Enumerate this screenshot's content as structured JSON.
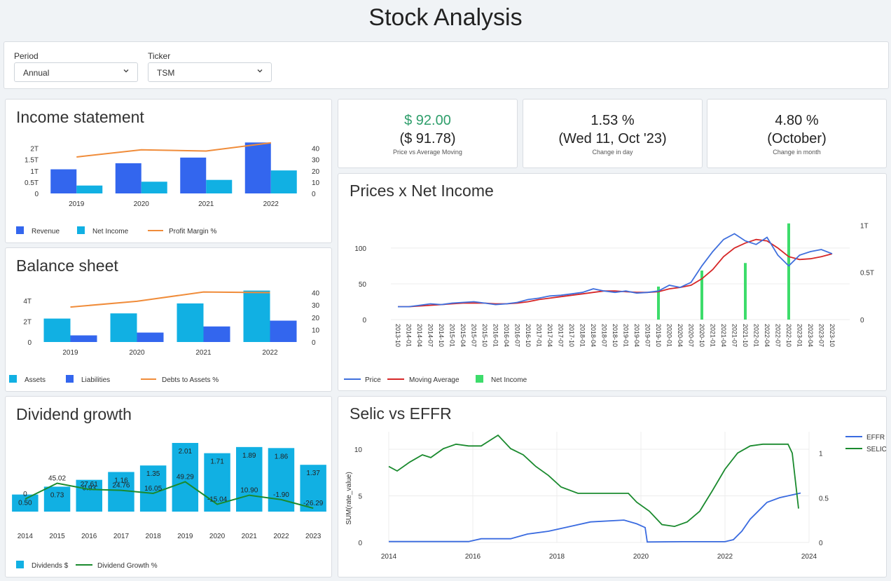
{
  "page": {
    "title": "Stock Analysis"
  },
  "filters": {
    "period": {
      "label": "Period",
      "value": "Annual"
    },
    "ticker": {
      "label": "Ticker",
      "value": "TSM"
    }
  },
  "kpis": [
    {
      "main": "$ 92.00",
      "sub": "($ 91.78)",
      "caption": "Price vs Average Moving",
      "main_color": "#2e9e6b"
    },
    {
      "main": "1.53 %",
      "sub": "(Wed 11, Oct '23)",
      "caption": "Change in day",
      "main_color": "#222222"
    },
    {
      "main": "4.80 %",
      "sub": "(October)",
      "caption": "Change in month",
      "main_color": "#222222"
    }
  ],
  "income": {
    "title": "Income statement",
    "chart_data": {
      "type": "bar",
      "categories": [
        "2019",
        "2020",
        "2021",
        "2022"
      ],
      "series": [
        {
          "name": "Revenue",
          "kind": "bar",
          "axis": "left",
          "color": "#3366ee",
          "values": [
            1.07,
            1.34,
            1.59,
            2.26
          ]
        },
        {
          "name": "Net Income",
          "kind": "bar",
          "axis": "left",
          "color": "#11b0e3",
          "values": [
            0.35,
            0.52,
            0.6,
            1.02
          ]
        },
        {
          "name": "Profit Margin %",
          "kind": "line",
          "axis": "right",
          "color": "#f08c3a",
          "values": [
            32.3,
            38.7,
            37.6,
            44.9
          ]
        }
      ],
      "yticks": [
        "0",
        "0.5T",
        "1T",
        "1.5T",
        "2T"
      ],
      "ylim": [
        0,
        2.3
      ],
      "y2ticks": [
        "0",
        "10",
        "20",
        "30",
        "40"
      ],
      "y2lim": [
        0,
        46
      ]
    }
  },
  "balance": {
    "title": "Balance sheet",
    "chart_data": {
      "type": "bar",
      "categories": [
        "2019",
        "2020",
        "2021",
        "2022"
      ],
      "series": [
        {
          "name": "Assets",
          "kind": "bar",
          "axis": "left",
          "color": "#11b0e3",
          "values": [
            2.26,
            2.76,
            3.72,
            4.96
          ]
        },
        {
          "name": "Liabilities",
          "kind": "bar",
          "axis": "left",
          "color": "#3366ee",
          "values": [
            0.64,
            0.91,
            1.5,
            2.06
          ]
        },
        {
          "name": "Debts to Assets %",
          "kind": "line",
          "axis": "right",
          "color": "#f08c3a",
          "values": [
            28.3,
            33,
            40.5,
            40
          ]
        }
      ],
      "yticks": [
        "0",
        "2T",
        "4T"
      ],
      "ylim": [
        0,
        5
      ],
      "y2ticks": [
        "0",
        "10",
        "20",
        "30",
        "40"
      ],
      "y2lim": [
        0,
        42
      ]
    }
  },
  "dividend": {
    "title": "Dividend growth",
    "chart_data": {
      "type": "bar",
      "categories": [
        "2014",
        "2015",
        "2016",
        "2017",
        "2018",
        "2019",
        "2020",
        "2021",
        "2022",
        "2023"
      ],
      "series": [
        {
          "name": "Dividends $",
          "kind": "bar",
          "color": "#11b0e3",
          "values": [
            0.5,
            0.73,
            0.93,
            1.16,
            1.35,
            2.01,
            1.71,
            1.89,
            1.86,
            1.37
          ],
          "labels": [
            "0.50",
            "0.73",
            "0.93",
            "1.16",
            "1.35",
            "2.01",
            "1.71",
            "1.89",
            "1.86",
            "1.37"
          ]
        },
        {
          "name": "Dividend Growth %",
          "kind": "line",
          "color": "#1a8a2e",
          "values": [
            0,
            45.02,
            27.61,
            24.76,
            16.05,
            49.29,
            -15.04,
            10.9,
            -1.9,
            -26.29
          ],
          "labels": [
            "0",
            "45.02",
            "27.61",
            "24.76",
            "16.05",
            "49.29",
            "-15.04",
            "10.90",
            "-1.90",
            "-26.29"
          ]
        }
      ]
    }
  },
  "prices": {
    "title": "Prices x Net Income",
    "chart_data": {
      "type": "line",
      "x_labels": [
        "2013-10",
        "2014-01",
        "2014-04",
        "2014-07",
        "2014-10",
        "2015-01",
        "2015-04",
        "2015-07",
        "2015-10",
        "2016-01",
        "2016-04",
        "2016-07",
        "2016-10",
        "2017-01",
        "2017-04",
        "2017-07",
        "2017-10",
        "2018-01",
        "2018-04",
        "2018-07",
        "2018-10",
        "2019-01",
        "2019-04",
        "2019-07",
        "2019-10",
        "2020-01",
        "2020-04",
        "2020-07",
        "2020-10",
        "2021-01",
        "2021-04",
        "2021-07",
        "2021-10",
        "2022-01",
        "2022-04",
        "2022-07",
        "2022-10",
        "2023-01",
        "2023-04",
        "2023-07",
        "2023-10"
      ],
      "series": [
        {
          "name": "Price",
          "color": "#3f6fdd",
          "values": [
            18,
            18,
            20,
            22,
            21,
            23,
            24,
            25,
            23,
            21,
            22,
            24,
            28,
            30,
            33,
            34,
            36,
            38,
            43,
            40,
            38,
            40,
            37,
            38,
            40,
            48,
            45,
            52,
            75,
            95,
            112,
            120,
            110,
            105,
            115,
            90,
            75,
            90,
            95,
            98,
            92
          ]
        },
        {
          "name": "Moving Average",
          "color": "#d62728",
          "values": [
            18,
            18,
            19,
            20,
            21,
            22,
            23,
            23,
            23,
            22,
            22,
            23,
            25,
            28,
            30,
            32,
            34,
            36,
            38,
            40,
            40,
            39,
            38,
            38,
            39,
            43,
            45,
            48,
            57,
            70,
            88,
            100,
            107,
            112,
            110,
            100,
            88,
            84,
            85,
            88,
            92
          ]
        },
        {
          "name": "Net Income",
          "kind": "bar",
          "color": "#3ddc6b",
          "x": [
            "2019-10",
            "2020-10",
            "2021-10",
            "2022-10"
          ],
          "values": [
            0.35,
            0.52,
            0.6,
            1.02
          ]
        }
      ],
      "yticks": [
        "0",
        "50",
        "100"
      ],
      "ylim": [
        0,
        145
      ],
      "y2ticks": [
        "0",
        "0.5T",
        "1T"
      ],
      "y2lim": [
        0,
        1.1
      ]
    }
  },
  "selic": {
    "title": "Selic vs EFFR",
    "chart_data": {
      "type": "line",
      "ylabel": "SUM(rate_value)",
      "x_ticks": [
        "2014",
        "2016",
        "2018",
        "2020",
        "2022",
        "2024"
      ],
      "xlim": [
        2014,
        2024
      ],
      "yticks": [
        "0",
        "5",
        "10"
      ],
      "ylim": [
        0,
        11.5
      ],
      "y2ticks": [
        "0",
        "0.5",
        "1"
      ],
      "y2lim": [
        0,
        1.2
      ],
      "series": [
        {
          "name": "EFFR",
          "axis": "left",
          "color": "#3a6be0",
          "x": [
            2014,
            2015,
            2015.9,
            2016.2,
            2016.9,
            2017.3,
            2017.8,
            2018.3,
            2018.8,
            2019.6,
            2019.9,
            2020.1,
            2020.15,
            2021,
            2022,
            2022.2,
            2022.4,
            2022.6,
            2022.8,
            2023,
            2023.3,
            2023.6,
            2023.8
          ],
          "values": [
            0.1,
            0.1,
            0.1,
            0.4,
            0.4,
            0.9,
            1.2,
            1.7,
            2.2,
            2.4,
            2.0,
            1.6,
            0.05,
            0.08,
            0.08,
            0.3,
            1.2,
            2.5,
            3.4,
            4.3,
            4.8,
            5.1,
            5.3
          ]
        },
        {
          "name": "SELIC",
          "axis": "right",
          "color": "#1a8a2e",
          "x": [
            2014,
            2014.2,
            2014.5,
            2014.8,
            2015,
            2015.3,
            2015.6,
            2015.9,
            2016.2,
            2016.6,
            2016.9,
            2017.2,
            2017.5,
            2017.8,
            2018.1,
            2018.5,
            2018.9,
            2019.3,
            2019.7,
            2019.9,
            2020.2,
            2020.5,
            2020.8,
            2021.1,
            2021.4,
            2021.7,
            2022,
            2022.3,
            2022.6,
            2022.9,
            2023.2,
            2023.5,
            2023.6,
            2023.75
          ],
          "values": [
            0.85,
            0.8,
            0.9,
            0.98,
            0.95,
            1.05,
            1.1,
            1.08,
            1.08,
            1.2,
            1.05,
            0.98,
            0.85,
            0.75,
            0.62,
            0.55,
            0.55,
            0.55,
            0.55,
            0.45,
            0.35,
            0.2,
            0.18,
            0.23,
            0.35,
            0.58,
            0.82,
            1.0,
            1.08,
            1.1,
            1.1,
            1.1,
            1.0,
            0.38
          ]
        }
      ]
    }
  }
}
